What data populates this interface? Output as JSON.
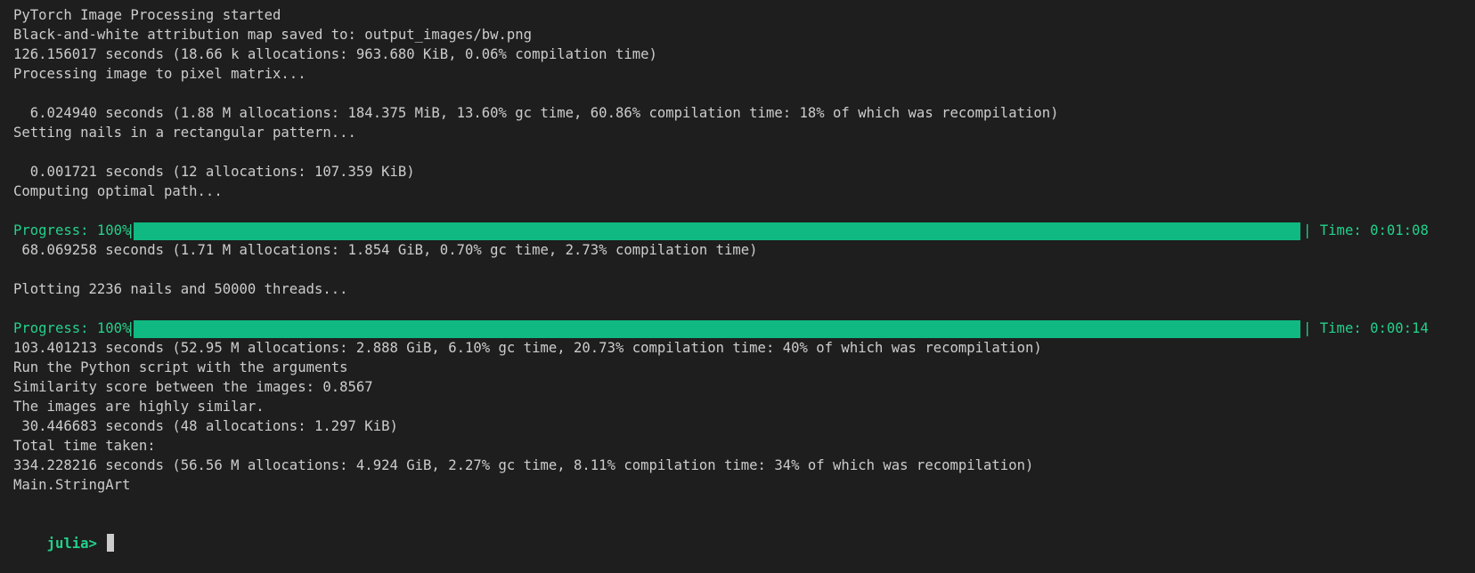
{
  "lines": {
    "l1": "PyTorch Image Processing started",
    "l2": "Black-and-white attribution map saved to: output_images/bw.png",
    "l3": "126.156017 seconds (18.66 k allocations: 963.680 KiB, 0.06% compilation time)",
    "l4": "Processing image to pixel matrix...",
    "l6": "  6.024940 seconds (1.88 M allocations: 184.375 MiB, 13.60% gc time, 60.86% compilation time: 18% of which was recompilation)",
    "l7": "Setting nails in a rectangular pattern...",
    "l9": "  0.001721 seconds (12 allocations: 107.359 KiB)",
    "l10": "Computing optimal path...",
    "l13": " 68.069258 seconds (1.71 M allocations: 1.854 GiB, 0.70% gc time, 2.73% compilation time)",
    "l15": "Plotting 2236 nails and 50000 threads...",
    "l18": "103.401213 seconds (52.95 M allocations: 2.888 GiB, 6.10% gc time, 20.73% compilation time: 40% of which was recompilation)",
    "l19": "Run the Python script with the arguments",
    "l20": "Similarity score between the images: 0.8567",
    "l21": "The images are highly similar.",
    "l22": " 30.446683 seconds (48 allocations: 1.297 KiB)",
    "l23": "Total time taken:",
    "l24": "334.228216 seconds (56.56 M allocations: 4.924 GiB, 2.27% gc time, 8.11% compilation time: 34% of which was recompilation)",
    "l25": "Main.StringArt"
  },
  "progress_bars": [
    {
      "label": "Progress: 100%",
      "percent": 100,
      "time": "Time: 0:01:08"
    },
    {
      "label": "Progress: 100%",
      "percent": 100,
      "time": "Time: 0:00:14"
    }
  ],
  "prompt": "julia>",
  "colors": {
    "background": "#1e1e1e",
    "text": "#cccccc",
    "green": "#23d18b",
    "bar_fill": "#10b981"
  }
}
